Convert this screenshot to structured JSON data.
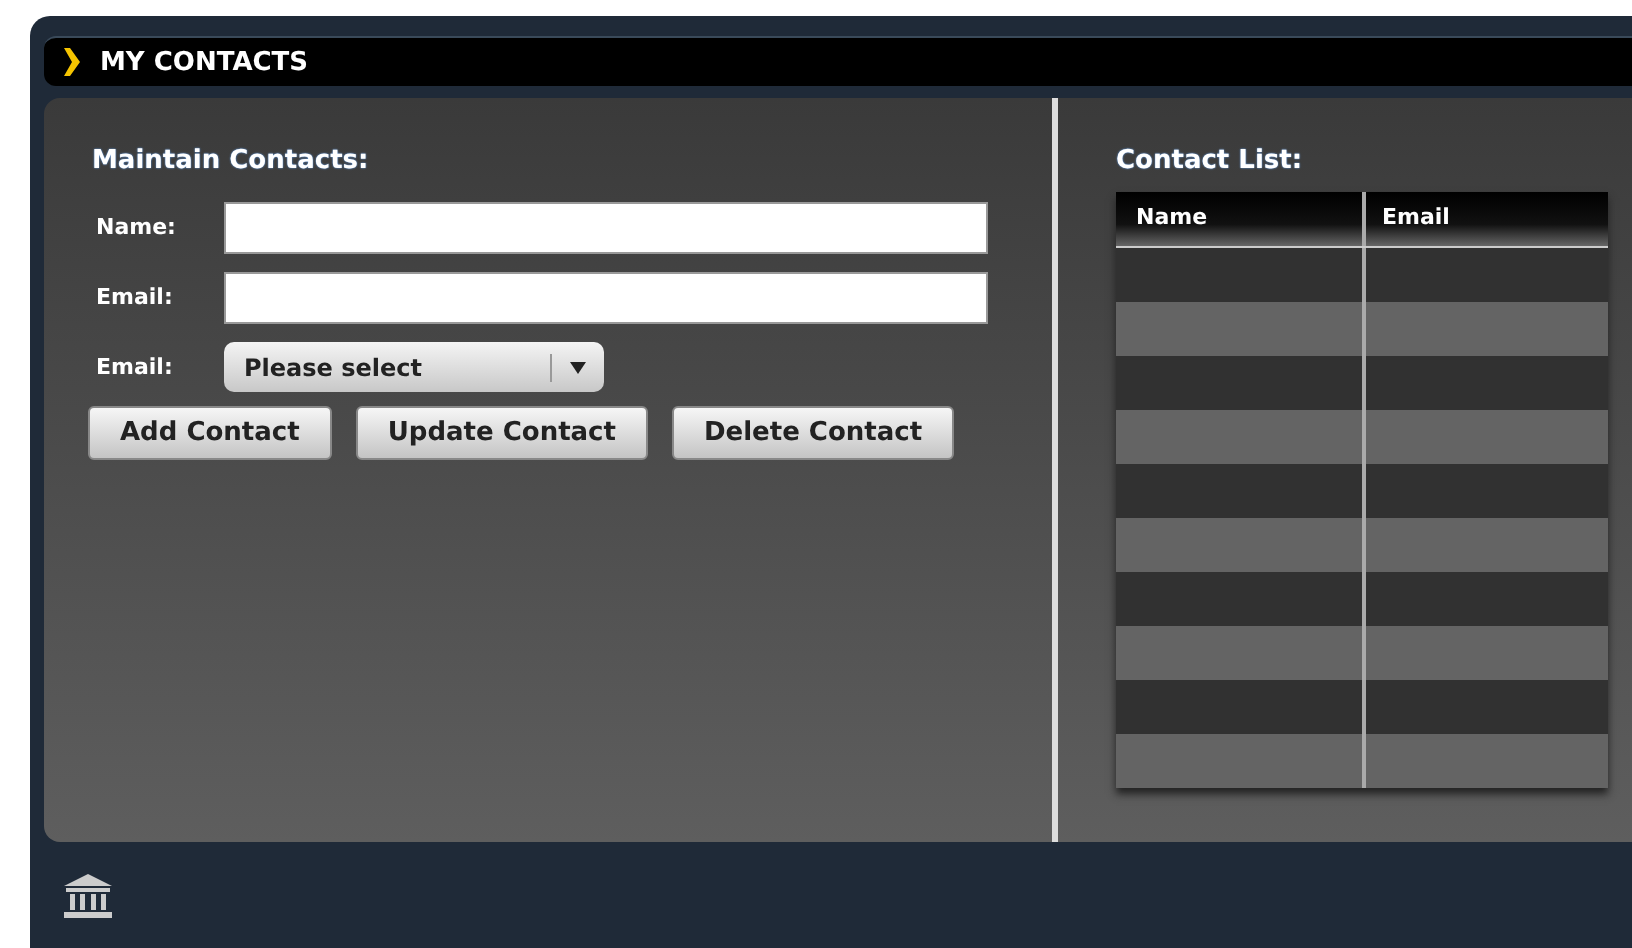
{
  "window": {
    "title": "MY CONTACTS"
  },
  "maintain": {
    "heading": "Maintain Contacts:",
    "fields": [
      {
        "kind": "text",
        "label": "Name:"
      },
      {
        "kind": "text",
        "label": "Email:"
      },
      {
        "kind": "select",
        "label": "Email:",
        "value": "Please select"
      }
    ],
    "buttons": [
      "Add Contact",
      "Update Contact",
      "Delete Contact"
    ]
  },
  "contact_list": {
    "heading": "Contact List:",
    "columns": [
      "Name",
      "Email"
    ],
    "rows": [
      {
        "kind": "dark"
      },
      {
        "kind": "light"
      },
      {
        "kind": "dark"
      },
      {
        "kind": "light"
      },
      {
        "kind": "dark"
      },
      {
        "kind": "light"
      },
      {
        "kind": "dark"
      },
      {
        "kind": "light"
      },
      {
        "kind": "dark"
      },
      {
        "kind": "light"
      }
    ]
  }
}
